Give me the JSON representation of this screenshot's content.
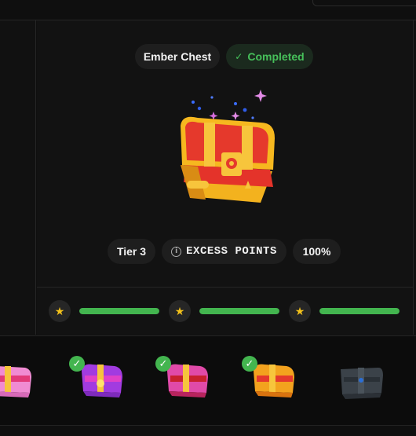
{
  "chest": {
    "name": "Ember Chest",
    "status": "Completed",
    "tier": "Tier 3",
    "excess_label": "EXCESS POINTS",
    "percent": "100%",
    "progress": [
      1.0,
      1.0,
      1.0
    ]
  },
  "icons": {
    "check": "✓",
    "info": "i",
    "star": "★"
  },
  "chest_strip": [
    {
      "name": "pink-chest",
      "completed": false
    },
    {
      "name": "purple-chest",
      "completed": true
    },
    {
      "name": "magenta-chest",
      "completed": true
    },
    {
      "name": "ember-chest",
      "completed": true
    },
    {
      "name": "steel-chest",
      "completed": false
    }
  ],
  "colors": {
    "accent_green": "#43b54f",
    "star_gold": "#f4c21b",
    "background": "#0f0f0f"
  }
}
